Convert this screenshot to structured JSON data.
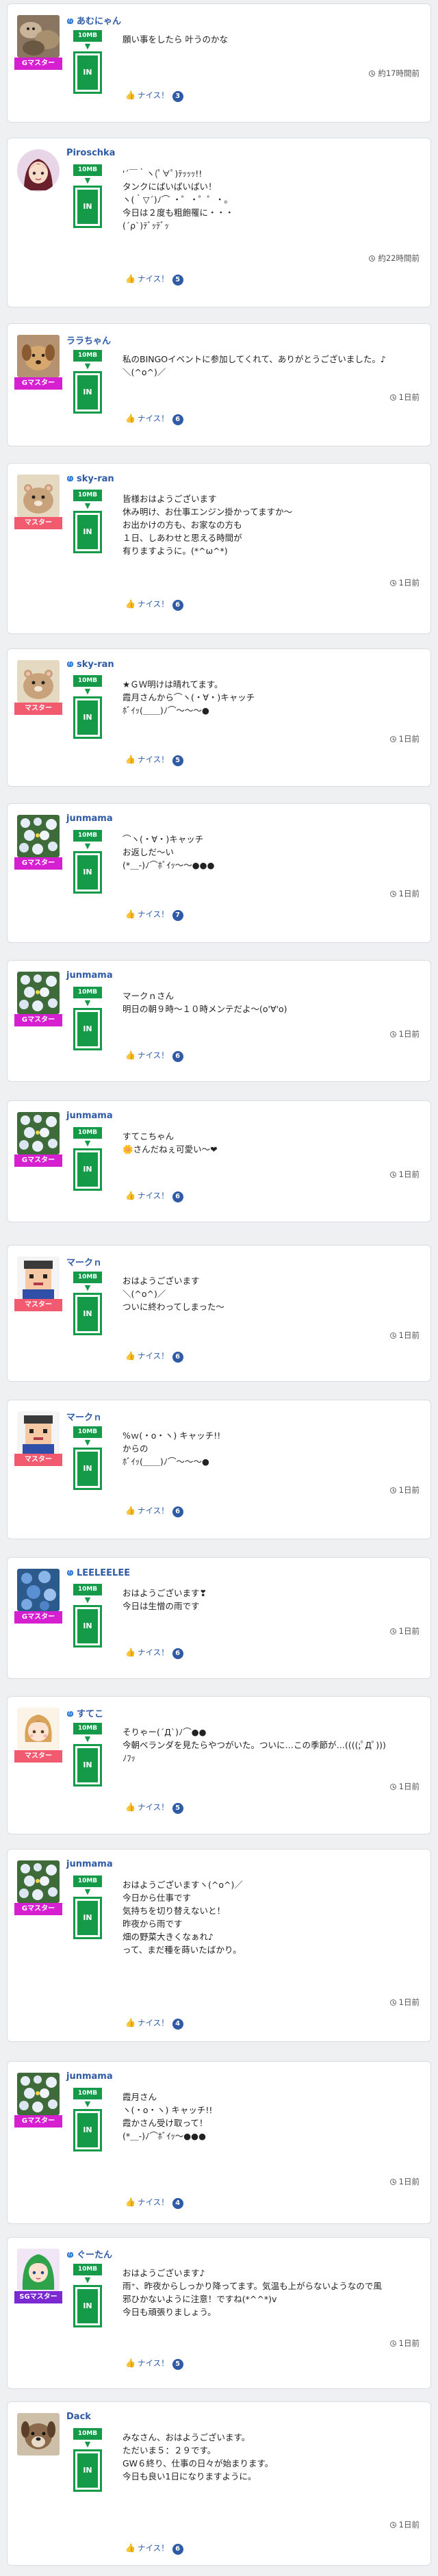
{
  "colors": {
    "badge_gmaster": "#d51fd1",
    "badge_master": "#f25a6f",
    "badge_sgmaster": "#7a2ad0",
    "level_green": "#159a4a",
    "link_blue": "#2e5aa6",
    "like_badge": "#2e5aa6"
  },
  "icons": {
    "user_mark": "bird-icon",
    "like": "thumbs-up-icon",
    "time": "clock-icon"
  },
  "posts": [
    {
      "username": "あむにゃん",
      "has_mark": true,
      "badge": "Gマスター",
      "badge_color": "#d51fd1",
      "level": "10MB",
      "room": "IN",
      "avatar": "cat-pile",
      "lines": [
        "願い事をしたら 叶うのかな"
      ],
      "time": "約17時間前",
      "like_label": "ナイス！",
      "likes": "3"
    },
    {
      "username": "Piroschka",
      "has_mark": false,
      "badge": "",
      "badge_color": "",
      "level": "10MB",
      "room": "IN",
      "avatar": "anime-girl",
      "lines": [
        "'´￣｀ヽ(ﾟ∀ﾟ)ﾃｯｯｯ!!",
        "タンクにぱいぱいぱい！",
        "ヽ(｀▽´)ﾉ⌒ ・゜・゜゜・。",
        "今日は２度も粗飽罹に・・・",
        "(´ρ`)ﾃﾞｯﾃﾞｯ"
      ],
      "time": "約22時間前",
      "like_label": "ナイス！",
      "likes": "5"
    },
    {
      "username": "ララちゃん",
      "has_mark": false,
      "badge": "Gマスター",
      "badge_color": "#d51fd1",
      "level": "10MB",
      "room": "IN",
      "avatar": "brown-dog",
      "lines": [
        "私のBINGOイベントに参加してくれて、ありがとうございました。♪",
        "＼(^o^)／"
      ],
      "time": "1日前",
      "like_label": "ナイス！",
      "likes": "6"
    },
    {
      "username": "sky-ran",
      "has_mark": true,
      "badge": "マスター",
      "badge_color": "#f25a6f",
      "level": "10MB",
      "room": "IN",
      "avatar": "hamster",
      "lines": [
        "皆様おはようございます",
        "休み明け、お仕事エンジン掛かってますか〜",
        "お出かけの方も、お家なの方も",
        "１日、しあわせと思える時間が",
        "有りますように。(*^ω^*)"
      ],
      "time": "1日前",
      "like_label": "ナイス！",
      "likes": "6"
    },
    {
      "username": "sky-ran",
      "has_mark": true,
      "badge": "マスター",
      "badge_color": "#f25a6f",
      "level": "10MB",
      "room": "IN",
      "avatar": "hamster",
      "lines": [
        "★ＧＷ明けは晴れてます。",
        "霞月さんから⌒ヽ(・∀・)キャッチ",
        "ﾎﾞｲｯ(＿＿)ﾉ⌒〜〜〜●"
      ],
      "time": "1日前",
      "like_label": "ナイス！",
      "likes": "5"
    },
    {
      "username": "junmama",
      "has_mark": false,
      "badge": "Gマスター",
      "badge_color": "#d51fd1",
      "level": "10MB",
      "room": "IN",
      "avatar": "flower-bush",
      "lines": [
        "⌒ヽ(・∀・)キャッチ",
        "お返しだ〜い",
        "(*＿-)ﾉ⌒ﾎﾞｲｯ〜〜●●●"
      ],
      "time": "1日前",
      "like_label": "ナイス！",
      "likes": "7"
    },
    {
      "username": "junmama",
      "has_mark": false,
      "badge": "Gマスター",
      "badge_color": "#d51fd1",
      "level": "10MB",
      "room": "IN",
      "avatar": "flower-bush",
      "lines": [
        "マークｎさん",
        "明日の朝９時〜１０時メンテだよ〜(o'∀'o)"
      ],
      "time": "1日前",
      "like_label": "ナイス！",
      "likes": "6"
    },
    {
      "username": "junmama",
      "has_mark": false,
      "badge": "Gマスター",
      "badge_color": "#d51fd1",
      "level": "10MB",
      "room": "IN",
      "avatar": "flower-bush",
      "lines": [
        "すてこちゃん",
        "🌼さんだねぇ可愛い〜❤"
      ],
      "time": "1日前",
      "like_label": "ナイス！",
      "likes": "6"
    },
    {
      "username": "マークｎ",
      "has_mark": false,
      "badge": "マスター",
      "badge_color": "#f25a6f",
      "level": "10MB",
      "room": "IN",
      "avatar": "pixel-face",
      "lines": [
        "おはようございます",
        "＼(^o^)／",
        "ついに終わってしまった〜"
      ],
      "time": "1日前",
      "like_label": "ナイス！",
      "likes": "6"
    },
    {
      "username": "マークｎ",
      "has_mark": false,
      "badge": "マスター",
      "badge_color": "#f25a6f",
      "level": "10MB",
      "room": "IN",
      "avatar": "pixel-face",
      "lines": [
        "%ｗ(・o・ヽ) キャッチ!!",
        "からの",
        "ﾎﾞｲｯ(＿＿)ﾉ⌒〜〜〜●"
      ],
      "time": "1日前",
      "like_label": "ナイス！",
      "likes": "6"
    },
    {
      "username": "LEELEELEE",
      "has_mark": true,
      "badge": "Gマスター",
      "badge_color": "#d51fd1",
      "level": "10MB",
      "room": "IN",
      "avatar": "blue-flowers",
      "lines": [
        "おはようございます❣",
        "今日は生憎の雨です"
      ],
      "time": "1日前",
      "like_label": "ナイス！",
      "likes": "6"
    },
    {
      "username": "すてこ",
      "has_mark": true,
      "badge": "マスター",
      "badge_color": "#f25a6f",
      "level": "10MB",
      "room": "IN",
      "avatar": "chibi-girl",
      "lines": [
        "そりゃー(´Д`)ﾉ⌒●●",
        "今朝ベランダを見たらやつがいた。ついに…この季節が…((((;ﾟДﾟ)))",
        "ﾉﾌｯ"
      ],
      "time": "1日前",
      "like_label": "ナイス！",
      "likes": "5"
    },
    {
      "username": "junmama",
      "has_mark": false,
      "badge": "Gマスター",
      "badge_color": "#d51fd1",
      "level": "10MB",
      "room": "IN",
      "avatar": "flower-bush",
      "lines": [
        "おはようございますヽ(^o^)／",
        "今日から仕事です",
        "気持ちを切り替えないと！",
        "昨夜から雨です",
        "畑の野菜大きくなぁれ♪",
        "って、まだ種を蒔いたばかり。"
      ],
      "time": "1日前",
      "like_label": "ナイス！",
      "likes": "4"
    },
    {
      "username": "junmama",
      "has_mark": false,
      "badge": "Gマスター",
      "badge_color": "#d51fd1",
      "level": "10MB",
      "room": "IN",
      "avatar": "flower-bush",
      "lines": [
        "霞月さん",
        "ヽ(・o・ヽ) キャッチ!!",
        "霞かさん受け取って！",
        "(*＿-)ﾉ⌒ﾎﾞｲｯ〜●●●"
      ],
      "time": "1日前",
      "like_label": "ナイス！",
      "likes": "4"
    },
    {
      "username": "ぐーたん",
      "has_mark": true,
      "badge": "SGマスター",
      "badge_color": "#7a2ad0",
      "level": "10MB",
      "room": "IN",
      "avatar": "green-hair-girl",
      "lines": [
        "おはようございます♪",
        "雨⁺、昨夜からしっかり降ってます。気温も上がらないようなので風",
        "邪ひかないように注意！ですね(*^^*)v",
        "今日も頑張りましょう。"
      ],
      "time": "1日前",
      "like_label": "ナイス！",
      "likes": "5"
    },
    {
      "username": "Dack",
      "has_mark": false,
      "badge": "",
      "badge_color": "",
      "level": "10MB",
      "room": "IN",
      "avatar": "dog-face",
      "lines": [
        "みなさん、おはようございます。",
        "ただいま５：２９です。",
        "GW６終り、仕事の日々が始まります。",
        "今日も良い1日になりますように。"
      ],
      "time": "1日前",
      "like_label": "ナイス！",
      "likes": "6"
    }
  ]
}
